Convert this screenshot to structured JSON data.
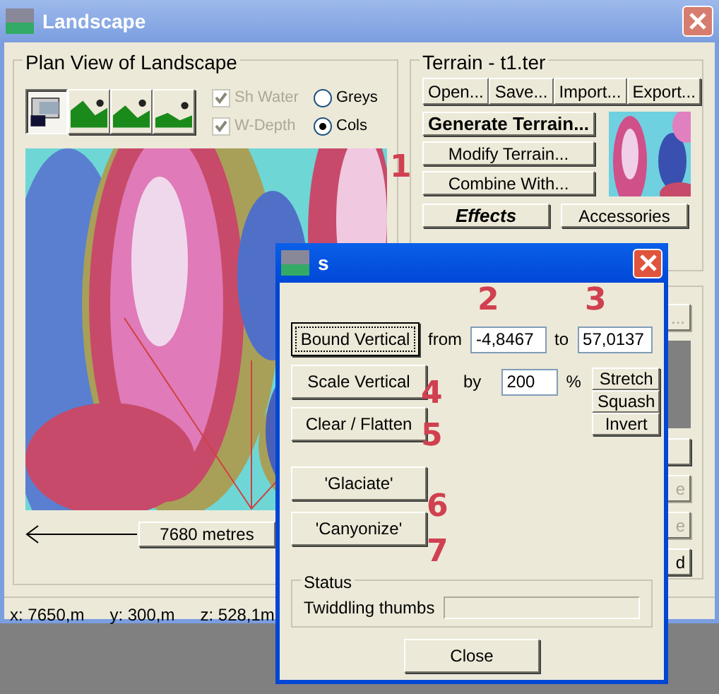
{
  "window": {
    "title": "Landscape"
  },
  "plan_view": {
    "title": "Plan View of Landscape",
    "view_buttons": [
      {
        "kind": "monitor",
        "selected": true
      },
      {
        "kind": "high",
        "selected": false
      },
      {
        "kind": "mid",
        "selected": false
      },
      {
        "kind": "low",
        "selected": false
      }
    ],
    "options": [
      {
        "kind": "checkbox",
        "label": "Sh Water",
        "checked": true,
        "disabled": true
      },
      {
        "kind": "radio",
        "label": "Greys",
        "selected": false
      },
      {
        "kind": "checkbox",
        "label": "W-Depth",
        "checked": true,
        "disabled": true
      },
      {
        "kind": "radio",
        "label": "Cols",
        "selected": true
      }
    ],
    "scale_label": "7680 metres"
  },
  "terrain": {
    "title": "Terrain - t1.ter",
    "file_buttons": [
      "Open...",
      "Save...",
      "Import...",
      "Export..."
    ],
    "action_buttons": [
      {
        "label": "Generate Terrain...",
        "bold": true
      },
      {
        "label": "Modify Terrain...",
        "bold": false,
        "note": "1"
      },
      {
        "label": "Combine With...",
        "bold": false
      }
    ],
    "extra_buttons": [
      {
        "label": "Effects",
        "bold": true
      },
      {
        "label": "Accessories",
        "bold": false
      }
    ]
  },
  "covered_buttons": [
    {
      "label": "...",
      "disabled": true
    },
    {
      "disabled": false
    },
    {
      "label": "e",
      "disabled": true
    },
    {
      "label": "e",
      "disabled": true
    },
    {
      "label": "d",
      "disabled": false
    }
  ],
  "status_bar": [
    "x: 7650,m",
    "y: 300,m",
    "z: 528,1m"
  ],
  "dialog": {
    "title": "s",
    "bound": {
      "label": "Bound Vertical",
      "from_label": "from",
      "from_value": "-4,8467",
      "from_note": "2",
      "to_label": "to",
      "to_value": "57,0137",
      "to_note": "3"
    },
    "scale": {
      "label": "Scale Vertical",
      "note": "4",
      "by_label": "by",
      "value": "200",
      "unit": "%"
    },
    "side_buttons": [
      "Stretch",
      "Squash",
      "Invert"
    ],
    "clear": {
      "label": "Clear / Flatten",
      "note": "5"
    },
    "tools": [
      {
        "label": "'Glaciate'",
        "note": "6"
      },
      {
        "label": "'Canyonize'",
        "note": "7"
      }
    ],
    "status": {
      "title": "Status",
      "text": "Twiddling thumbs",
      "level": 0
    },
    "close": "Close"
  }
}
